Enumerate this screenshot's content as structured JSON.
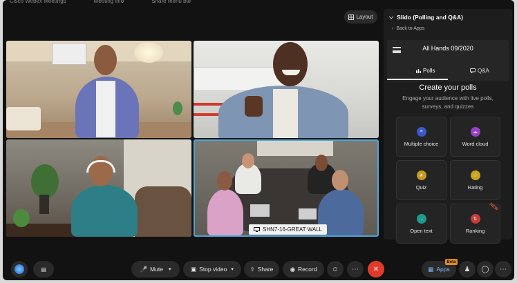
{
  "top_strip": [
    "Cisco Webex Meetings",
    "Meeting info",
    "Share menu bar"
  ],
  "layout_button": {
    "label": "Layout",
    "icon": "layout-grid-icon"
  },
  "room_label": {
    "text": "SHN7-16-GREAT WALL",
    "icon": "room-device-icon"
  },
  "panel": {
    "title": "Slido (Polling and Q&A)",
    "back_label": "Back to Apps",
    "event_name": "All Hands 09/2020",
    "tabs": [
      {
        "label": "Polls",
        "icon": "bar-chart-icon"
      },
      {
        "label": "Q&A",
        "icon": "chat-bubble-icon"
      }
    ],
    "heading": "Create your polls",
    "description": "Engage your audience with live polls, surveys, and quizzes",
    "poll_types": [
      {
        "label": "Multiple choice",
        "icon": "list-icon",
        "color": "#3c59c8"
      },
      {
        "label": "Word cloud",
        "icon": "cloud-icon",
        "color": "#9b3ec9"
      },
      {
        "label": "Quiz",
        "icon": "trophy-icon",
        "color": "#c99a1d"
      },
      {
        "label": "Rating",
        "icon": "star-icon",
        "color": "#c9a41d"
      },
      {
        "label": "Open text",
        "icon": "speech-icon",
        "color": "#1d9a8a"
      },
      {
        "label": "Ranking",
        "icon": "ranking-icon",
        "color": "#c93b3b",
        "badge": "NEW"
      }
    ]
  },
  "toolbar": {
    "mute": "Mute",
    "stop_video": "Stop video",
    "share": "Share",
    "record": "Record",
    "apps": "Apps",
    "beta": "Beta"
  },
  "colors": {
    "accent": "#49a6d8",
    "end_call": "#e23b2e",
    "background": "#121212"
  }
}
